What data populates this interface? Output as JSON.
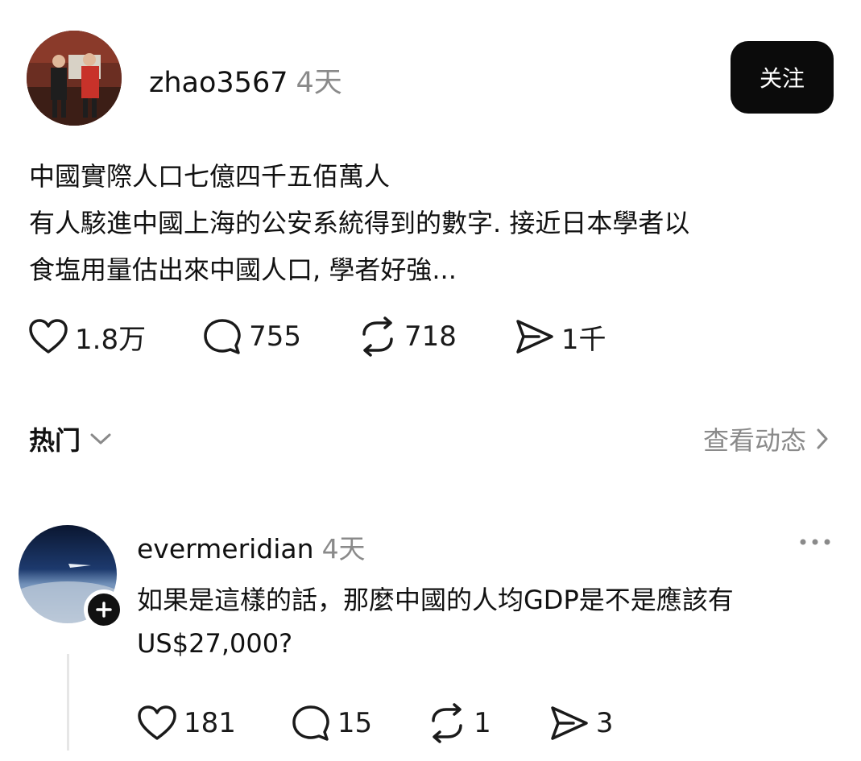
{
  "post": {
    "username": "zhao3567",
    "time": "4天",
    "follow_label": "关注",
    "text": "中國實際人口七億四千五佰萬人\n有人駭進中國上海的公安系統得到的數字. 接近日本學者以\n食塩用量估出來中國人口, 學者好強...",
    "likes": "1.8万",
    "comments": "755",
    "reposts": "718",
    "shares": "1千"
  },
  "sort": {
    "label": "热门",
    "view_activity": "查看动态"
  },
  "comment": {
    "username": "evermeridian",
    "time": "4天",
    "text": "如果是這樣的話，那麼中國的人均GDP是不是應該有\nUS$27,000?",
    "likes": "181",
    "comments": "15",
    "reposts": "1",
    "shares": "3"
  },
  "icons": {
    "like": "heart-icon",
    "comment": "comment-bubble-icon",
    "repost": "repost-icon",
    "share": "send-icon",
    "more": "more-dots-icon",
    "chevron": "chevron-down-icon",
    "arrow": "chevron-right-icon",
    "plus": "plus-icon"
  }
}
